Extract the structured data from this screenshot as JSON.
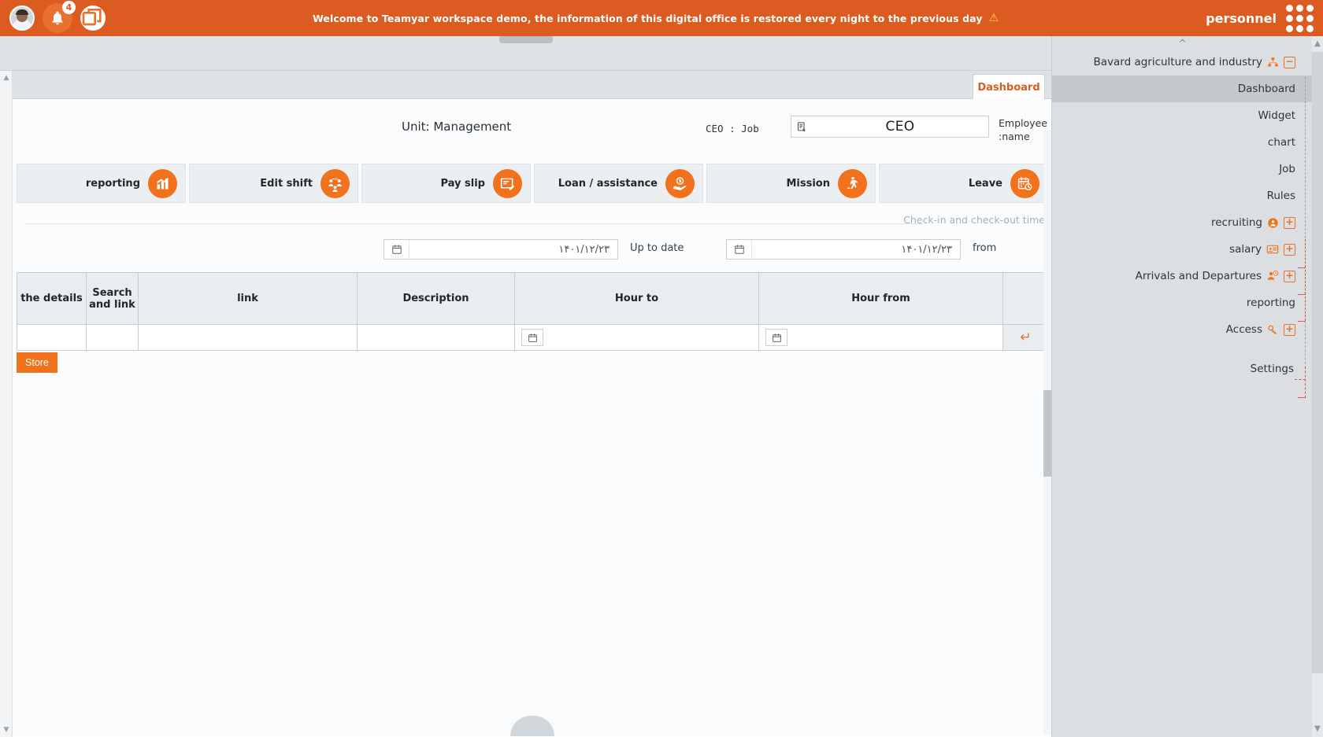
{
  "topbar": {
    "notification_count": "4",
    "banner": "Welcome to Teamyar workspace demo, the information of this digital office is restored every night to the previous day",
    "warning_icon": "warning-triangle-icon",
    "brand": "personnel",
    "avatar_name": "user-avatar",
    "bell_name": "notification-bell-icon",
    "windows_name": "restore-window-icon",
    "grid_name": "app-grid-icon",
    "bg_color": "#DC5B21"
  },
  "tabs": {
    "dashboard": "Dashboard"
  },
  "header": {
    "unit_title": "Unit: Management",
    "job_label": "CEO  : Job",
    "job_value": "CEO",
    "employee_label_line1": "Employee",
    "employee_label_line2": ":name"
  },
  "tiles": [
    {
      "label": "reporting",
      "icon": "chart-bar-icon"
    },
    {
      "label": "Edit shift",
      "icon": "people-group-icon"
    },
    {
      "label": "Pay slip",
      "icon": "invoice-edit-icon"
    },
    {
      "label": "Loan / assistance",
      "icon": "hand-dollar-icon"
    },
    {
      "label": "Mission",
      "icon": "walking-person-icon"
    },
    {
      "label": "Leave",
      "icon": "calendar-clock-icon"
    }
  ],
  "legend": {
    "checkin_caption": "Check-in and check-out time"
  },
  "datefilter": {
    "up_to_date_label": "Up to date",
    "up_to_date_value": "۱۴۰۱/۱۲/۲۳",
    "from_label": "from",
    "from_value": "۱۴۰۱/۱۲/۲۳",
    "calendar_icon": "calendar-icon"
  },
  "table": {
    "columns": [
      "the details",
      "Search and link",
      "link",
      "Description",
      "Hour to",
      "Hour from",
      ""
    ],
    "rows": [
      {
        "details": "",
        "search_and_link": "",
        "link": "",
        "description": "",
        "hour_to": "",
        "hour_from": "",
        "enter_icon": "enter-return-icon"
      }
    ]
  },
  "actions": {
    "store_label": "Store",
    "accent_color": "#F2711C"
  },
  "sidebar": {
    "root": {
      "label": "Bavard agriculture and industry",
      "icon": "org-chart-icon",
      "toggle": "−"
    },
    "items": [
      {
        "label": "Dashboard",
        "icon": null,
        "toggle": null,
        "active": true
      },
      {
        "label": "Widget",
        "icon": null,
        "toggle": null,
        "active": false
      },
      {
        "label": "chart",
        "icon": null,
        "toggle": null,
        "active": false
      },
      {
        "label": "Job",
        "icon": null,
        "toggle": null,
        "active": false
      },
      {
        "label": "Rules",
        "icon": null,
        "toggle": null,
        "active": false
      },
      {
        "label": "recruiting",
        "icon": "user-circle-icon",
        "toggle": "+",
        "active": false
      },
      {
        "label": "salary",
        "icon": "id-card-icon",
        "toggle": "+",
        "active": false
      },
      {
        "label": "Arrivals and Departures",
        "icon": "user-clock-icon",
        "toggle": "+",
        "active": false
      },
      {
        "label": "reporting",
        "icon": null,
        "toggle": null,
        "active": false
      },
      {
        "label": "Access",
        "icon": "key-icon",
        "toggle": "+",
        "active": false
      }
    ],
    "settings": "Settings"
  }
}
